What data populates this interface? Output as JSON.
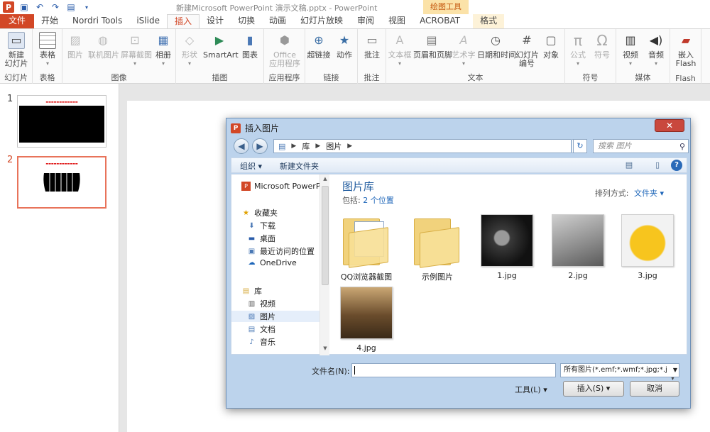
{
  "titlebar": {
    "document_title": "新建Microsoft PowerPoint 演示文稿.pptx - PowerPoint",
    "contextual_tab_group": "绘图工具"
  },
  "tabs": [
    "文件",
    "开始",
    "Nordri Tools",
    "iSlide",
    "插入",
    "设计",
    "切换",
    "动画",
    "幻灯片放映",
    "审阅",
    "视图",
    "ACROBAT",
    "格式"
  ],
  "active_tab": "插入",
  "ribbon": {
    "groups": [
      {
        "label": "幻灯片",
        "buttons": [
          "新建\n幻灯片"
        ]
      },
      {
        "label": "表格",
        "buttons": [
          "表格"
        ]
      },
      {
        "label": "图像",
        "buttons": [
          "图片",
          "联机图片",
          "屏幕截图",
          "相册"
        ]
      },
      {
        "label": "插图",
        "buttons": [
          "形状",
          "SmartArt",
          "图表"
        ]
      },
      {
        "label": "应用程序",
        "buttons": [
          "Office\n应用程序"
        ]
      },
      {
        "label": "链接",
        "buttons": [
          "超链接",
          "动作"
        ]
      },
      {
        "label": "批注",
        "buttons": [
          "批注"
        ]
      },
      {
        "label": "文本",
        "buttons": [
          "文本框",
          "页眉和页脚",
          "艺术字",
          "日期和时间",
          "幻灯片\n编号",
          "对象"
        ]
      },
      {
        "label": "符号",
        "buttons": [
          "公式",
          "符号"
        ]
      },
      {
        "label": "媒体",
        "buttons": [
          "视频",
          "音频"
        ]
      },
      {
        "label": "Flash",
        "buttons": [
          "嵌入\nFlash"
        ]
      }
    ]
  },
  "slides": [
    {
      "number": "1"
    },
    {
      "number": "2"
    }
  ],
  "dialog": {
    "title": "插入图片",
    "address": [
      "库",
      "图片"
    ],
    "search_placeholder": "搜索 图片",
    "toolbar": {
      "organize": "组织 ▾",
      "new_folder": "新建文件夹"
    },
    "nav": {
      "app_item": "Microsoft PowerP",
      "favorites": "收藏夹",
      "downloads": "下载",
      "desktop": "桌面",
      "recent": "最近访问的位置",
      "onedrive": "OneDrive",
      "libraries": "库",
      "videos": "视频",
      "pictures": "图片",
      "documents": "文档",
      "music": "音乐"
    },
    "library_title": "图片库",
    "library_includes": "包括:",
    "library_locations": "2 个位置",
    "sort_label": "排列方式:",
    "sort_value": "文件夹 ▾",
    "files": [
      "QQ浏览器截图",
      "示例图片",
      "1.jpg",
      "2.jpg",
      "3.jpg",
      "4.jpg"
    ],
    "filename_label": "文件名(N):",
    "filename_value": "",
    "filter_value": "所有图片(*.emf;*.wmf;*.jpg;*.j",
    "tools_label": "工具(L)",
    "insert_label": "插入(S)",
    "cancel_label": "取消"
  }
}
